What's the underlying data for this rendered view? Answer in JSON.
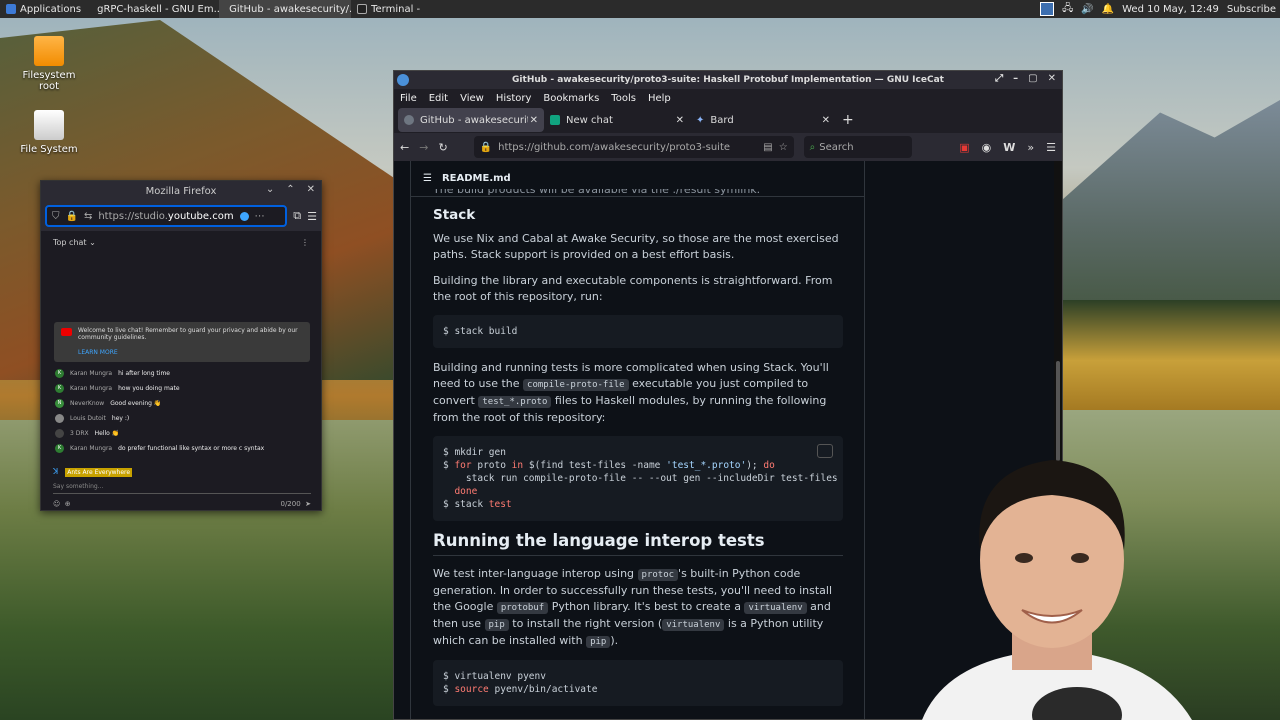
{
  "top_panel": {
    "applications": "Applications",
    "tasks": [
      "gRPC-haskell - GNU Em...",
      "GitHub - awakesecurity/...",
      "Terminal -"
    ],
    "clock": "Wed 10 May, 12:49",
    "subscribe": "Subscribe"
  },
  "desktop": {
    "icons": [
      {
        "label": "Filesystem\nroot"
      },
      {
        "label": "File System"
      }
    ]
  },
  "firefox": {
    "title": "Mozilla Firefox",
    "url_prefix": "https://studio.",
    "url_domain": "youtube.com",
    "chat_mode": "Top chat",
    "welcome_text": "Welcome to live chat! Remember to guard your privacy and abide by our community guidelines.",
    "learn_more": "LEARN MORE",
    "messages": [
      {
        "name": "Karan Mungra",
        "text": "hi after long time",
        "color": "#2e7d32",
        "initial": "K"
      },
      {
        "name": "Karan Mungra",
        "text": "how you doing mate",
        "color": "#2e7d32",
        "initial": "K"
      },
      {
        "name": "NeverKnow",
        "text": "Good evening 👋",
        "color": "#388e3c",
        "initial": "N"
      },
      {
        "name": "Louis Dutoit",
        "text": "hey :)",
        "color": "#888888",
        "initial": ""
      },
      {
        "name": "3 DRX",
        "text": "Hello 👏",
        "color": "#444444",
        "initial": ""
      },
      {
        "name": "Karan Mungra",
        "text": "do prefer functional like syntax or more c syntax",
        "color": "#2e7d32",
        "initial": "K"
      }
    ],
    "highlight_name": "Ants Are Everywhere",
    "say_placeholder": "Say something...",
    "char_count": "0/200"
  },
  "icecat": {
    "title": "GitHub - awakesecurity/proto3-suite: Haskell Protobuf Implementation — GNU IceCat",
    "menu": [
      "File",
      "Edit",
      "View",
      "History",
      "Bookmarks",
      "Tools",
      "Help"
    ],
    "tabs": [
      {
        "label": "GitHub - awakesecurity/p",
        "color": "#6e7681"
      },
      {
        "label": "New chat",
        "color": "#10a37f"
      },
      {
        "label": "Bard",
        "color": "#8ab4f8"
      }
    ],
    "url": "https://github.com/awakesecurity/proto3-suite",
    "search_placeholder": "Search"
  },
  "readme": {
    "filename": "README.md",
    "cut_line": "The build products will be available via the ./result symlink.",
    "stack_heading": "Stack",
    "p1": "We use Nix and Cabal at Awake Security, so those are the most exercised paths. Stack support is provided on a best effort basis.",
    "p2": "Building the library and executable components is straightforward. From the root of this repository, run:",
    "code1": "$ stack build",
    "p3_a": "Building and running tests is more complicated when using Stack. You'll need to use the ",
    "p3_code1": "compile-proto-file",
    "p3_b": " executable you just compiled to convert ",
    "p3_code2": "test_*.proto",
    "p3_c": " files to Haskell modules, by running the following from the root of this repository:",
    "code2_l1": "$ mkdir gen",
    "code2_l2a": "$ ",
    "code2_for": "for",
    "code2_l2b": " proto ",
    "code2_in": "in",
    "code2_l2c": " $(find test-files -name ",
    "code2_str": "'test_*.proto'",
    "code2_l2d": "); ",
    "code2_do": "do",
    "code2_l3": "    stack run compile-proto-file -- --out gen --includeDir test-files --p",
    "code2_done": "  done",
    "code2_l5a": "$ stack ",
    "code2_test": "test",
    "interop_heading": "Running the language interop tests",
    "p4_a": "We test inter-language interop using ",
    "p4_code1": "protoc",
    "p4_b": "'s built-in Python code generation. In order to successfully run these tests, you'll need to install the Google ",
    "p4_code2": "protobuf",
    "p4_c": " Python library. It's best to create a ",
    "p4_code3": "virtualenv",
    "p4_d": " and then use ",
    "p4_code4": "pip",
    "p4_e": " to install the right version (",
    "p4_code5": "virtualenv",
    "p4_f": " is a Python utility which can be installed with ",
    "p4_code6": "pip",
    "p4_g": ").",
    "code3_l1": "$ virtualenv pyenv",
    "code3_l2a": "$ ",
    "code3_source": "source",
    "code3_l2b": " pyenv/bin/activate"
  }
}
